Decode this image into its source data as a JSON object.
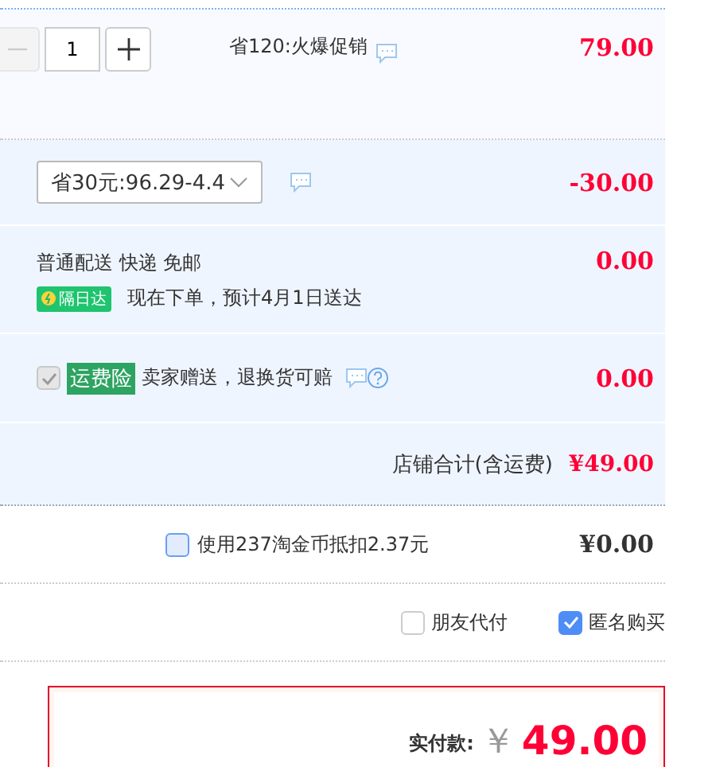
{
  "item": {
    "quantity": "1",
    "minus_disabled": true,
    "promo": "省120:火爆促销",
    "price": "79.00"
  },
  "coupon": {
    "value": "省30元:96.29-4.4",
    "amount": "-30.00"
  },
  "shipping": {
    "method": "普通配送 快递 免邮",
    "badge": "隔日达",
    "eta": "现在下单，预计4月1日送达",
    "amount": "0.00"
  },
  "insurance": {
    "checked": true,
    "disabled": true,
    "tag": "运费险",
    "text": "卖家赠送，退换货可赔",
    "amount": "0.00"
  },
  "shop_total": {
    "label": "店铺合计(含运费)",
    "amount": "¥49.00"
  },
  "coins": {
    "checked": false,
    "label": "使用237淘金币抵扣2.37元",
    "amount": "¥0.00"
  },
  "options": [
    {
      "label": "朋友代付",
      "checked": false
    },
    {
      "label": "匿名购买",
      "checked": true
    }
  ],
  "payment": {
    "label": "实付款:",
    "currency": "￥",
    "amount": "49.00"
  }
}
